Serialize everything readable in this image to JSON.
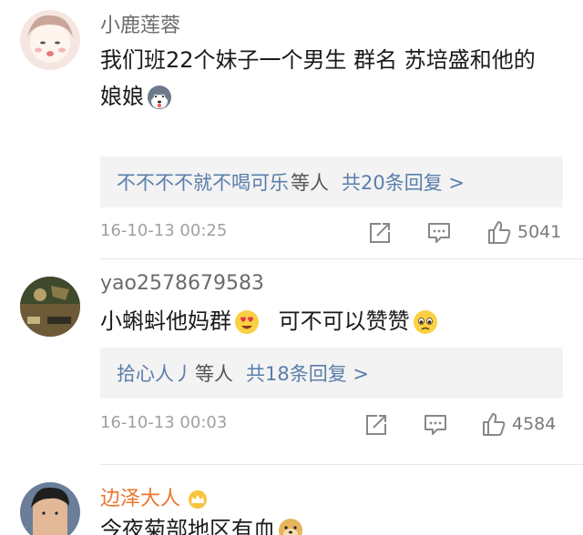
{
  "comments": [
    {
      "username": "小鹿莲蓉",
      "text_line1": "我们班22个妹子一个男生 群名 苏培盛和他的",
      "text_line2": "娘娘",
      "reply": {
        "names": "不不不不就不喝可乐",
        "etc": "等人",
        "count": "共20条回复 >"
      },
      "time": "16-10-13 00:25",
      "likes": "5041"
    },
    {
      "username": "yao2578679583",
      "text_a": "小蝌蚪他妈群",
      "text_b": "可不可以赞赞",
      "reply": {
        "names": "拾心人丿",
        "etc": "等人",
        "count": "共18条回复 >"
      },
      "time": "16-10-13 00:03",
      "likes": "4584"
    },
    {
      "username": "边泽大人",
      "text": "今夜菊部地区有血"
    }
  ],
  "colors": {
    "link": "#5a7eab",
    "vip_name": "#e9762e",
    "meta": "#a0a0a0"
  }
}
